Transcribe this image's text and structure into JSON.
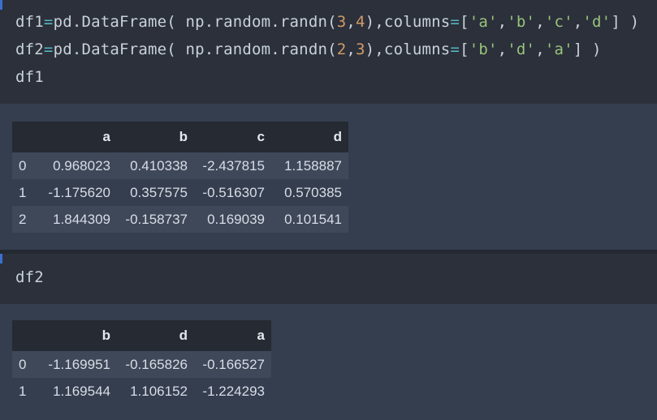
{
  "cells": [
    {
      "code_lines": [
        [
          {
            "t": "df1",
            "c": ""
          },
          {
            "t": "=",
            "c": "op"
          },
          {
            "t": "pd.DataFrame( np.random.randn(",
            "c": ""
          },
          {
            "t": "3",
            "c": "num"
          },
          {
            "t": ",",
            "c": ""
          },
          {
            "t": "4",
            "c": "num"
          },
          {
            "t": "),columns",
            "c": ""
          },
          {
            "t": "=",
            "c": "op"
          },
          {
            "t": "[",
            "c": ""
          },
          {
            "t": "'a'",
            "c": "str"
          },
          {
            "t": ",",
            "c": ""
          },
          {
            "t": "'b'",
            "c": "str"
          },
          {
            "t": ",",
            "c": ""
          },
          {
            "t": "'c'",
            "c": "str"
          },
          {
            "t": ",",
            "c": ""
          },
          {
            "t": "'d'",
            "c": "str"
          },
          {
            "t": "] )",
            "c": ""
          }
        ],
        [
          {
            "t": "df2",
            "c": ""
          },
          {
            "t": "=",
            "c": "op"
          },
          {
            "t": "pd.DataFrame( np.random.randn(",
            "c": ""
          },
          {
            "t": "2",
            "c": "num"
          },
          {
            "t": ",",
            "c": ""
          },
          {
            "t": "3",
            "c": "num"
          },
          {
            "t": "),columns",
            "c": ""
          },
          {
            "t": "=",
            "c": "op"
          },
          {
            "t": "[",
            "c": ""
          },
          {
            "t": "'b'",
            "c": "str"
          },
          {
            "t": ",",
            "c": ""
          },
          {
            "t": "'d'",
            "c": "str"
          },
          {
            "t": ",",
            "c": ""
          },
          {
            "t": "'a'",
            "c": "str"
          },
          {
            "t": "] )",
            "c": ""
          }
        ],
        [
          {
            "t": "df1",
            "c": ""
          }
        ]
      ]
    },
    {
      "code_lines": [
        [
          {
            "t": "df2",
            "c": ""
          }
        ]
      ]
    }
  ],
  "df1": {
    "columns": [
      "",
      "a",
      "b",
      "c",
      "d"
    ],
    "rows": [
      [
        "0",
        "0.968023",
        "0.410338",
        "-2.437815",
        "1.158887"
      ],
      [
        "1",
        "-1.175620",
        "0.357575",
        "-0.516307",
        "0.570385"
      ],
      [
        "2",
        "1.844309",
        "-0.158737",
        "0.169039",
        "0.101541"
      ]
    ]
  },
  "df2": {
    "columns": [
      "",
      "b",
      "d",
      "a"
    ],
    "rows": [
      [
        "0",
        "-1.169951",
        "-0.165826",
        "-0.166527"
      ],
      [
        "1",
        "1.169544",
        "1.106152",
        "-1.224293"
      ]
    ]
  }
}
